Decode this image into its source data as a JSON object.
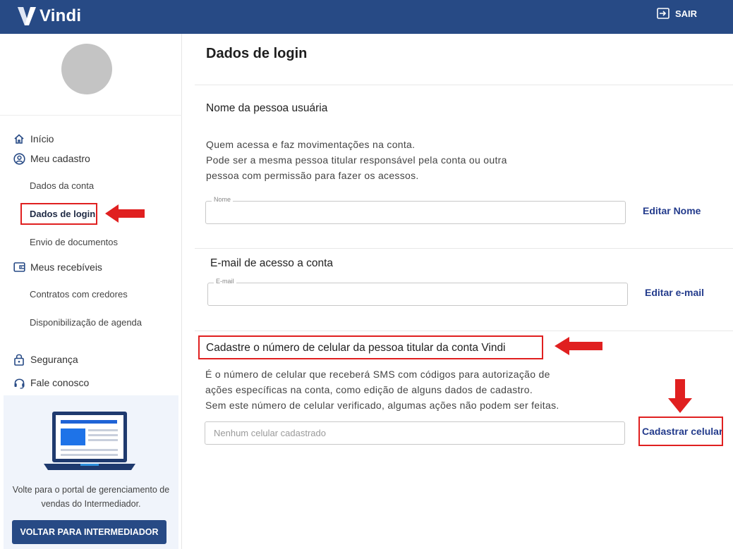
{
  "header": {
    "brand": "Vindi",
    "logout_label": "SAIR",
    "logout_icon": "logout-icon",
    "bg_color": "#274a85"
  },
  "sidebar": {
    "nav": [
      {
        "label": "Início",
        "icon": "home-icon"
      },
      {
        "label": "Meu cadastro",
        "icon": "user-circle-icon"
      },
      {
        "label": "Meus recebíveis",
        "icon": "wallet-icon"
      },
      {
        "label": "Segurança",
        "icon": "lock-icon"
      },
      {
        "label": "Fale conosco",
        "icon": "headset-icon"
      }
    ],
    "sub_cadastro": [
      "Dados da conta",
      "Dados de login",
      "Envio de documentos"
    ],
    "sub_recebiveis": [
      "Contratos com credores",
      "Disponibilização de agenda"
    ],
    "active_item": "Dados de login",
    "promo": {
      "text": "Volte para o portal de gerenciamento de vendas do Intermediador.",
      "button_label": "VOLTAR PARA INTERMEDIADOR"
    }
  },
  "main": {
    "title": "Dados de login",
    "sections": [
      {
        "title": "Nome da pessoa usuária",
        "description": [
          "Quem acessa e faz movimentações na conta.",
          "Pode ser a mesma pessoa titular responsável pela conta ou outra",
          "pessoa com permissão para fazer os acessos."
        ],
        "field_label": "Nome",
        "field_value": "",
        "action_label": "Editar Nome"
      },
      {
        "title": "E-mail de acesso a conta",
        "field_label": "E-mail",
        "field_value": "",
        "action_label": "Editar e-mail"
      },
      {
        "title": "Cadastre o número de celular da pessoa titular da conta Vindi",
        "description": [
          "É o número de celular que receberá SMS com códigos para autorização de",
          "ações específicas na conta, como edição de alguns dados de cadastro.",
          "Sem este número de celular verificado, algumas ações não podem ser feitas."
        ],
        "field_placeholder": "Nenhum celular cadastrado",
        "action_label": "Cadastrar celular"
      }
    ]
  },
  "annotations": {
    "highlight_color": "#e02020"
  }
}
